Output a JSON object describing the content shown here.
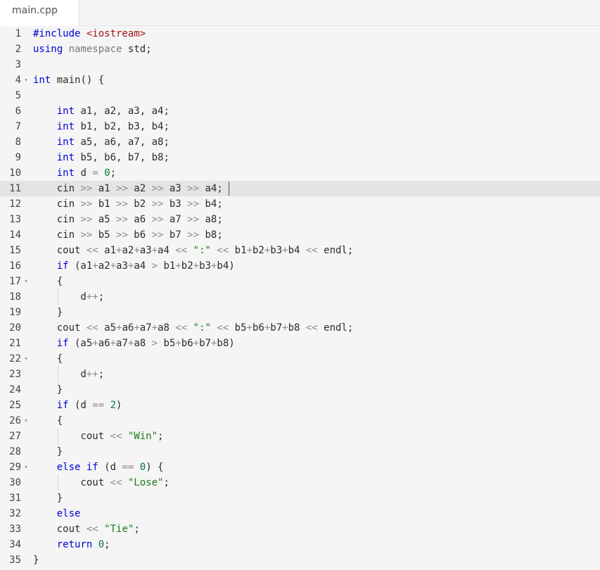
{
  "tab": {
    "filename": "main.cpp"
  },
  "editor": {
    "active_line": 11,
    "lines": [
      {
        "n": "1",
        "fold": false,
        "guide": false,
        "tokens": [
          {
            "t": "#include ",
            "c": "pre"
          },
          {
            "t": "<iostream>",
            "c": "str"
          }
        ]
      },
      {
        "n": "2",
        "fold": false,
        "guide": false,
        "tokens": [
          {
            "t": "using",
            "c": "kw"
          },
          {
            "t": " ",
            "c": "plain"
          },
          {
            "t": "namespace",
            "c": "gray"
          },
          {
            "t": " std;",
            "c": "plain"
          }
        ]
      },
      {
        "n": "3",
        "fold": false,
        "guide": false,
        "tokens": []
      },
      {
        "n": "4",
        "fold": true,
        "guide": false,
        "tokens": [
          {
            "t": "int",
            "c": "ty"
          },
          {
            "t": " main() {",
            "c": "plain"
          }
        ]
      },
      {
        "n": "5",
        "fold": false,
        "guide": false,
        "tokens": []
      },
      {
        "n": "6",
        "fold": false,
        "guide": false,
        "tokens": [
          {
            "t": "    ",
            "c": "plain"
          },
          {
            "t": "int",
            "c": "ty"
          },
          {
            "t": " a1, a2, a3, a4;",
            "c": "plain"
          }
        ]
      },
      {
        "n": "7",
        "fold": false,
        "guide": false,
        "tokens": [
          {
            "t": "    ",
            "c": "plain"
          },
          {
            "t": "int",
            "c": "ty"
          },
          {
            "t": " b1, b2, b3, b4;",
            "c": "plain"
          }
        ]
      },
      {
        "n": "8",
        "fold": false,
        "guide": false,
        "tokens": [
          {
            "t": "    ",
            "c": "plain"
          },
          {
            "t": "int",
            "c": "ty"
          },
          {
            "t": " a5, a6, a7, a8;",
            "c": "plain"
          }
        ]
      },
      {
        "n": "9",
        "fold": false,
        "guide": false,
        "tokens": [
          {
            "t": "    ",
            "c": "plain"
          },
          {
            "t": "int",
            "c": "ty"
          },
          {
            "t": " b5, b6, b7, b8;",
            "c": "plain"
          }
        ]
      },
      {
        "n": "10",
        "fold": false,
        "guide": false,
        "tokens": [
          {
            "t": "    ",
            "c": "plain"
          },
          {
            "t": "int",
            "c": "ty"
          },
          {
            "t": " d ",
            "c": "plain"
          },
          {
            "t": "=",
            "c": "op"
          },
          {
            "t": " ",
            "c": "plain"
          },
          {
            "t": "0",
            "c": "num"
          },
          {
            "t": ";",
            "c": "plain"
          }
        ]
      },
      {
        "n": "11",
        "fold": false,
        "guide": false,
        "tokens": [
          {
            "t": "    cin ",
            "c": "plain"
          },
          {
            "t": ">>",
            "c": "op"
          },
          {
            "t": " a1 ",
            "c": "plain"
          },
          {
            "t": ">>",
            "c": "op"
          },
          {
            "t": " a2 ",
            "c": "plain"
          },
          {
            "t": ">>",
            "c": "op"
          },
          {
            "t": " a3 ",
            "c": "plain"
          },
          {
            "t": ">>",
            "c": "op"
          },
          {
            "t": " a4;",
            "c": "plain"
          }
        ]
      },
      {
        "n": "12",
        "fold": false,
        "guide": false,
        "tokens": [
          {
            "t": "    cin ",
            "c": "plain"
          },
          {
            "t": ">>",
            "c": "op"
          },
          {
            "t": " b1 ",
            "c": "plain"
          },
          {
            "t": ">>",
            "c": "op"
          },
          {
            "t": " b2 ",
            "c": "plain"
          },
          {
            "t": ">>",
            "c": "op"
          },
          {
            "t": " b3 ",
            "c": "plain"
          },
          {
            "t": ">>",
            "c": "op"
          },
          {
            "t": " b4;",
            "c": "plain"
          }
        ]
      },
      {
        "n": "13",
        "fold": false,
        "guide": false,
        "tokens": [
          {
            "t": "    cin ",
            "c": "plain"
          },
          {
            "t": ">>",
            "c": "op"
          },
          {
            "t": " a5 ",
            "c": "plain"
          },
          {
            "t": ">>",
            "c": "op"
          },
          {
            "t": " a6 ",
            "c": "plain"
          },
          {
            "t": ">>",
            "c": "op"
          },
          {
            "t": " a7 ",
            "c": "plain"
          },
          {
            "t": ">>",
            "c": "op"
          },
          {
            "t": " a8;",
            "c": "plain"
          }
        ]
      },
      {
        "n": "14",
        "fold": false,
        "guide": false,
        "tokens": [
          {
            "t": "    cin ",
            "c": "plain"
          },
          {
            "t": ">>",
            "c": "op"
          },
          {
            "t": " b5 ",
            "c": "plain"
          },
          {
            "t": ">>",
            "c": "op"
          },
          {
            "t": " b6 ",
            "c": "plain"
          },
          {
            "t": ">>",
            "c": "op"
          },
          {
            "t": " b7 ",
            "c": "plain"
          },
          {
            "t": ">>",
            "c": "op"
          },
          {
            "t": " b8;",
            "c": "plain"
          }
        ]
      },
      {
        "n": "15",
        "fold": false,
        "guide": false,
        "tokens": [
          {
            "t": "    cout ",
            "c": "plain"
          },
          {
            "t": "<<",
            "c": "op"
          },
          {
            "t": " a1",
            "c": "plain"
          },
          {
            "t": "+",
            "c": "op"
          },
          {
            "t": "a2",
            "c": "plain"
          },
          {
            "t": "+",
            "c": "op"
          },
          {
            "t": "a3",
            "c": "plain"
          },
          {
            "t": "+",
            "c": "op"
          },
          {
            "t": "a4 ",
            "c": "plain"
          },
          {
            "t": "<<",
            "c": "op"
          },
          {
            "t": " ",
            "c": "plain"
          },
          {
            "t": "\":\"",
            "c": "strg"
          },
          {
            "t": " ",
            "c": "plain"
          },
          {
            "t": "<<",
            "c": "op"
          },
          {
            "t": " b1",
            "c": "plain"
          },
          {
            "t": "+",
            "c": "op"
          },
          {
            "t": "b2",
            "c": "plain"
          },
          {
            "t": "+",
            "c": "op"
          },
          {
            "t": "b3",
            "c": "plain"
          },
          {
            "t": "+",
            "c": "op"
          },
          {
            "t": "b4 ",
            "c": "plain"
          },
          {
            "t": "<<",
            "c": "op"
          },
          {
            "t": " endl;",
            "c": "plain"
          }
        ]
      },
      {
        "n": "16",
        "fold": false,
        "guide": false,
        "tokens": [
          {
            "t": "    ",
            "c": "plain"
          },
          {
            "t": "if",
            "c": "kw"
          },
          {
            "t": " (a1",
            "c": "plain"
          },
          {
            "t": "+",
            "c": "op"
          },
          {
            "t": "a2",
            "c": "plain"
          },
          {
            "t": "+",
            "c": "op"
          },
          {
            "t": "a3",
            "c": "plain"
          },
          {
            "t": "+",
            "c": "op"
          },
          {
            "t": "a4 ",
            "c": "plain"
          },
          {
            "t": ">",
            "c": "op"
          },
          {
            "t": " b1",
            "c": "plain"
          },
          {
            "t": "+",
            "c": "op"
          },
          {
            "t": "b2",
            "c": "plain"
          },
          {
            "t": "+",
            "c": "op"
          },
          {
            "t": "b3",
            "c": "plain"
          },
          {
            "t": "+",
            "c": "op"
          },
          {
            "t": "b4)",
            "c": "plain"
          }
        ]
      },
      {
        "n": "17",
        "fold": true,
        "guide": false,
        "tokens": [
          {
            "t": "    {",
            "c": "plain"
          }
        ]
      },
      {
        "n": "18",
        "fold": false,
        "guide": true,
        "tokens": [
          {
            "t": "        d",
            "c": "plain"
          },
          {
            "t": "++",
            "c": "op"
          },
          {
            "t": ";",
            "c": "plain"
          }
        ]
      },
      {
        "n": "19",
        "fold": false,
        "guide": false,
        "tokens": [
          {
            "t": "    }",
            "c": "plain"
          }
        ]
      },
      {
        "n": "20",
        "fold": false,
        "guide": false,
        "tokens": [
          {
            "t": "    cout ",
            "c": "plain"
          },
          {
            "t": "<<",
            "c": "op"
          },
          {
            "t": " a5",
            "c": "plain"
          },
          {
            "t": "+",
            "c": "op"
          },
          {
            "t": "a6",
            "c": "plain"
          },
          {
            "t": "+",
            "c": "op"
          },
          {
            "t": "a7",
            "c": "plain"
          },
          {
            "t": "+",
            "c": "op"
          },
          {
            "t": "a8 ",
            "c": "plain"
          },
          {
            "t": "<<",
            "c": "op"
          },
          {
            "t": " ",
            "c": "plain"
          },
          {
            "t": "\":\"",
            "c": "strg"
          },
          {
            "t": " ",
            "c": "plain"
          },
          {
            "t": "<<",
            "c": "op"
          },
          {
            "t": " b5",
            "c": "plain"
          },
          {
            "t": "+",
            "c": "op"
          },
          {
            "t": "b6",
            "c": "plain"
          },
          {
            "t": "+",
            "c": "op"
          },
          {
            "t": "b7",
            "c": "plain"
          },
          {
            "t": "+",
            "c": "op"
          },
          {
            "t": "b8 ",
            "c": "plain"
          },
          {
            "t": "<<",
            "c": "op"
          },
          {
            "t": " endl;",
            "c": "plain"
          }
        ]
      },
      {
        "n": "21",
        "fold": false,
        "guide": false,
        "tokens": [
          {
            "t": "    ",
            "c": "plain"
          },
          {
            "t": "if",
            "c": "kw"
          },
          {
            "t": " (a5",
            "c": "plain"
          },
          {
            "t": "+",
            "c": "op"
          },
          {
            "t": "a6",
            "c": "plain"
          },
          {
            "t": "+",
            "c": "op"
          },
          {
            "t": "a7",
            "c": "plain"
          },
          {
            "t": "+",
            "c": "op"
          },
          {
            "t": "a8 ",
            "c": "plain"
          },
          {
            "t": ">",
            "c": "op"
          },
          {
            "t": " b5",
            "c": "plain"
          },
          {
            "t": "+",
            "c": "op"
          },
          {
            "t": "b6",
            "c": "plain"
          },
          {
            "t": "+",
            "c": "op"
          },
          {
            "t": "b7",
            "c": "plain"
          },
          {
            "t": "+",
            "c": "op"
          },
          {
            "t": "b8)",
            "c": "plain"
          }
        ]
      },
      {
        "n": "22",
        "fold": true,
        "guide": false,
        "tokens": [
          {
            "t": "    {",
            "c": "plain"
          }
        ]
      },
      {
        "n": "23",
        "fold": false,
        "guide": true,
        "tokens": [
          {
            "t": "        d",
            "c": "plain"
          },
          {
            "t": "++",
            "c": "op"
          },
          {
            "t": ";",
            "c": "plain"
          }
        ]
      },
      {
        "n": "24",
        "fold": false,
        "guide": false,
        "tokens": [
          {
            "t": "    }",
            "c": "plain"
          }
        ]
      },
      {
        "n": "25",
        "fold": false,
        "guide": false,
        "tokens": [
          {
            "t": "    ",
            "c": "plain"
          },
          {
            "t": "if",
            "c": "kw"
          },
          {
            "t": " (d ",
            "c": "plain"
          },
          {
            "t": "==",
            "c": "op"
          },
          {
            "t": " ",
            "c": "plain"
          },
          {
            "t": "2",
            "c": "num"
          },
          {
            "t": ")",
            "c": "plain"
          }
        ]
      },
      {
        "n": "26",
        "fold": true,
        "guide": false,
        "tokens": [
          {
            "t": "    {",
            "c": "plain"
          }
        ]
      },
      {
        "n": "27",
        "fold": false,
        "guide": true,
        "tokens": [
          {
            "t": "        cout ",
            "c": "plain"
          },
          {
            "t": "<<",
            "c": "op"
          },
          {
            "t": " ",
            "c": "plain"
          },
          {
            "t": "\"Win\"",
            "c": "strg"
          },
          {
            "t": ";",
            "c": "plain"
          }
        ]
      },
      {
        "n": "28",
        "fold": false,
        "guide": false,
        "tokens": [
          {
            "t": "    }",
            "c": "plain"
          }
        ]
      },
      {
        "n": "29",
        "fold": true,
        "guide": false,
        "tokens": [
          {
            "t": "    ",
            "c": "plain"
          },
          {
            "t": "else",
            "c": "kw"
          },
          {
            "t": " ",
            "c": "plain"
          },
          {
            "t": "if",
            "c": "kw"
          },
          {
            "t": " (d ",
            "c": "plain"
          },
          {
            "t": "==",
            "c": "op"
          },
          {
            "t": " ",
            "c": "plain"
          },
          {
            "t": "0",
            "c": "num"
          },
          {
            "t": ") {",
            "c": "plain"
          }
        ]
      },
      {
        "n": "30",
        "fold": false,
        "guide": true,
        "tokens": [
          {
            "t": "        cout ",
            "c": "plain"
          },
          {
            "t": "<<",
            "c": "op"
          },
          {
            "t": " ",
            "c": "plain"
          },
          {
            "t": "\"Lose\"",
            "c": "strg"
          },
          {
            "t": ";",
            "c": "plain"
          }
        ]
      },
      {
        "n": "31",
        "fold": false,
        "guide": false,
        "tokens": [
          {
            "t": "    }",
            "c": "plain"
          }
        ]
      },
      {
        "n": "32",
        "fold": false,
        "guide": false,
        "tokens": [
          {
            "t": "    ",
            "c": "plain"
          },
          {
            "t": "else",
            "c": "kw"
          }
        ]
      },
      {
        "n": "33",
        "fold": false,
        "guide": false,
        "tokens": [
          {
            "t": "    cout ",
            "c": "plain"
          },
          {
            "t": "<<",
            "c": "op"
          },
          {
            "t": " ",
            "c": "plain"
          },
          {
            "t": "\"Tie\"",
            "c": "strg"
          },
          {
            "t": ";",
            "c": "plain"
          }
        ]
      },
      {
        "n": "34",
        "fold": false,
        "guide": false,
        "tokens": [
          {
            "t": "    ",
            "c": "plain"
          },
          {
            "t": "return",
            "c": "kw"
          },
          {
            "t": " ",
            "c": "plain"
          },
          {
            "t": "0",
            "c": "num"
          },
          {
            "t": ";",
            "c": "plain"
          }
        ]
      },
      {
        "n": "35",
        "fold": false,
        "guide": false,
        "tokens": [
          {
            "t": "}",
            "c": "plain"
          }
        ]
      }
    ]
  },
  "colors": {
    "keyword": "#0000d8",
    "string_include": "#a31515",
    "string_literal": "#1b7a1b",
    "number": "#097a3a",
    "operator": "#8a8a8a",
    "active_line_bg": "#e4e4e4"
  },
  "icons": {
    "fold": "caret-down-icon"
  }
}
